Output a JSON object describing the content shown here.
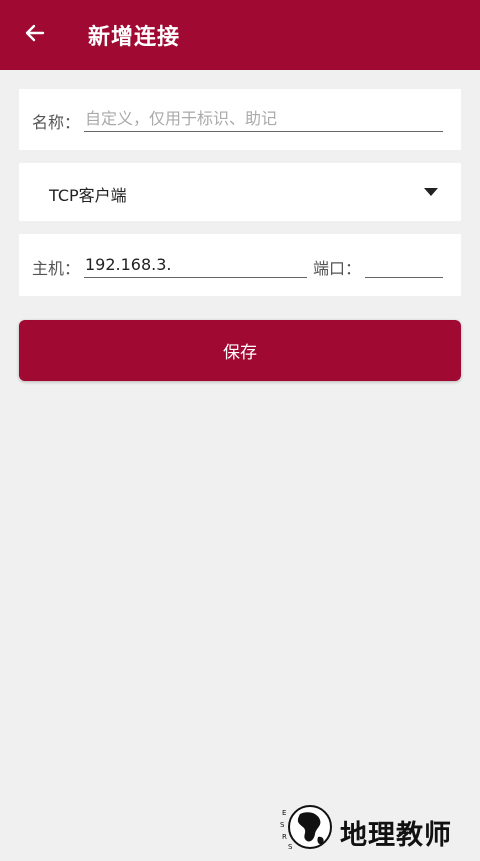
{
  "header": {
    "title": "新增连接"
  },
  "name_row": {
    "label": "名称：",
    "placeholder": "自定义，仅用于标识、助记",
    "value": ""
  },
  "type_select": {
    "selected": "TCP客户端"
  },
  "host_row": {
    "host_label": "主机：",
    "host_value": "192.168.3.",
    "port_label": "端口：",
    "port_value": ""
  },
  "actions": {
    "save_label": "保存"
  },
  "watermark": {
    "text": "地理教师",
    "logo_letters": "ESRS"
  },
  "colors": {
    "brand": "#a00a32",
    "background": "#f0f0f0",
    "card": "#ffffff"
  }
}
